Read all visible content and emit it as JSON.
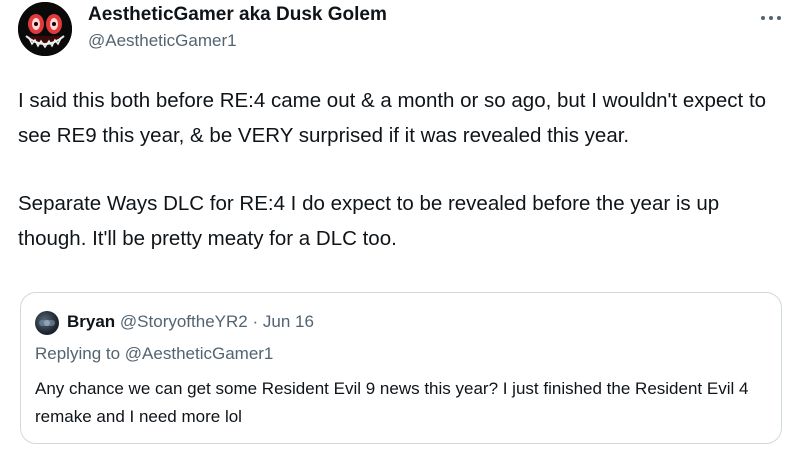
{
  "author": {
    "display_name": "AestheticGamer aka Dusk Golem",
    "handle": "@AestheticGamer1",
    "avatar_icon": "demon-face-avatar"
  },
  "more_icon": "ellipsis-icon",
  "tweet": {
    "paragraphs": [
      "I said this both before RE:4 came out & a month or so ago, but I wouldn't expect to see RE9 this year, & be VERY surprised if it was revealed this year.",
      "Separate Ways DLC for RE:4 I do expect to be revealed before the year is up though. It'll be pretty meaty for a DLC too."
    ]
  },
  "quoted_tweet": {
    "name": "Bryan",
    "handle": "@StoryoftheYR2",
    "separator": "·",
    "date": "Jun 16",
    "replying_prefix": "Replying to",
    "replying_handle": "@AestheticGamer1",
    "text": "Any chance we can get some Resident Evil 9 news this year? I just finished the Resident Evil 4 remake and I need more lol"
  },
  "colors": {
    "text_primary": "#0f1419",
    "text_secondary": "#536471",
    "border": "#cfd9de",
    "background": "#ffffff"
  }
}
